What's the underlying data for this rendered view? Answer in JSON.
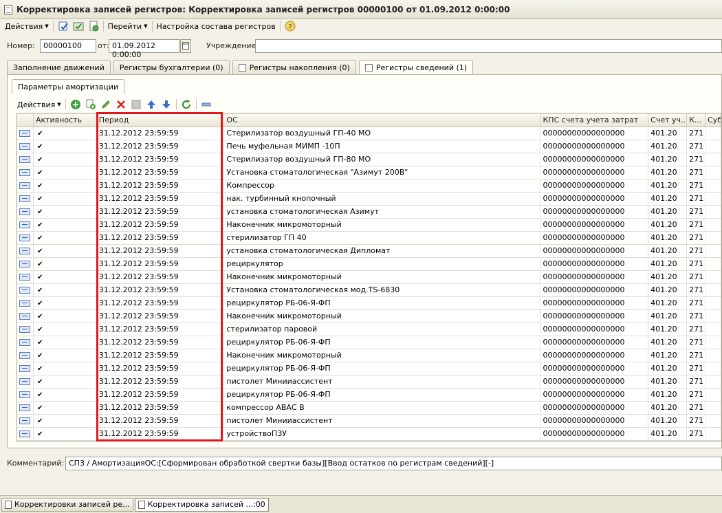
{
  "window": {
    "title": "Корректировка записей регистров: Корректировка записей регистров 00000100 от 01.09.2012 0:00:00"
  },
  "toolbar": {
    "actions_label": "Действия",
    "goto_label": "Перейти",
    "registers_setup_label": "Настройка состава регистров"
  },
  "header": {
    "number_label": "Номер:",
    "number_value": "00000100",
    "date_label": "от:",
    "date_value": "01.09.2012  0:00:00",
    "institution_label": "Учреждение:",
    "institution_value": ""
  },
  "tabs": [
    {
      "label": "Заполнение движений"
    },
    {
      "label": "Регистры бухгалтерии (0)"
    },
    {
      "label": "Регистры накопления (0)"
    },
    {
      "label": "Регистры сведений (1)"
    }
  ],
  "subtab": {
    "label": "Параметры амортизации"
  },
  "grid_toolbar": {
    "actions_label": "Действия"
  },
  "grid": {
    "columns": [
      "Активность",
      "Период",
      "ОС",
      "КПС счета учета затрат",
      "Счет уч...",
      "К...",
      "Суб"
    ],
    "rows": [
      {
        "period": "31.12.2012 23:59:59",
        "os": "Стерилизатор воздушный ГП-40 МО",
        "kps": "00000000000000000",
        "account": "401.20",
        "k": "271"
      },
      {
        "period": "31.12.2012 23:59:59",
        "os": "Печь муфельная  МИМП -10П",
        "kps": "00000000000000000",
        "account": "401.20",
        "k": "271"
      },
      {
        "period": "31.12.2012 23:59:59",
        "os": "Стерилизатор воздушный ГП-80 МО",
        "kps": "00000000000000000",
        "account": "401.20",
        "k": "271"
      },
      {
        "period": "31.12.2012 23:59:59",
        "os": "Установка стоматологическая \"Азимут 200В\"",
        "kps": "00000000000000000",
        "account": "401.20",
        "k": "271"
      },
      {
        "period": "31.12.2012 23:59:59",
        "os": "Компрессор",
        "kps": "00000000000000000",
        "account": "401.20",
        "k": "271"
      },
      {
        "period": "31.12.2012 23:59:59",
        "os": "нак. турбинный кнопочный",
        "kps": "00000000000000000",
        "account": "401.20",
        "k": "271"
      },
      {
        "period": "31.12.2012 23:59:59",
        "os": "установка стоматологическая Азимут",
        "kps": "00000000000000000",
        "account": "401.20",
        "k": "271"
      },
      {
        "period": "31.12.2012 23:59:59",
        "os": "Наконечник   микромоторный",
        "kps": "00000000000000000",
        "account": "401.20",
        "k": "271"
      },
      {
        "period": "31.12.2012 23:59:59",
        "os": "стерилизатор ГП 40",
        "kps": "00000000000000000",
        "account": "401.20",
        "k": "271"
      },
      {
        "period": "31.12.2012 23:59:59",
        "os": "установка стоматологическая Дипломат",
        "kps": "00000000000000000",
        "account": "401.20",
        "k": "271"
      },
      {
        "period": "31.12.2012 23:59:59",
        "os": "рециркулятор",
        "kps": "00000000000000000",
        "account": "401.20",
        "k": "271"
      },
      {
        "period": "31.12.2012 23:59:59",
        "os": "Наконечник   микромоторный",
        "kps": "00000000000000000",
        "account": "401.20",
        "k": "271"
      },
      {
        "period": "31.12.2012 23:59:59",
        "os": "Установка стоматологическая мод.TS-6830",
        "kps": "00000000000000000",
        "account": "401.20",
        "k": "271"
      },
      {
        "period": "31.12.2012 23:59:59",
        "os": "рециркулятор РБ-06-Я-ФП",
        "kps": "00000000000000000",
        "account": "401.20",
        "k": "271"
      },
      {
        "period": "31.12.2012 23:59:59",
        "os": "Наконечник   микромоторный",
        "kps": "00000000000000000",
        "account": "401.20",
        "k": "271"
      },
      {
        "period": "31.12.2012 23:59:59",
        "os": "стерилизатор паровой",
        "kps": "00000000000000000",
        "account": "401.20",
        "k": "271"
      },
      {
        "period": "31.12.2012 23:59:59",
        "os": "рециркулятор РБ-06-Я-ФП",
        "kps": "00000000000000000",
        "account": "401.20",
        "k": "271"
      },
      {
        "period": "31.12.2012 23:59:59",
        "os": "Наконечник   микромоторный",
        "kps": "00000000000000000",
        "account": "401.20",
        "k": "271"
      },
      {
        "period": "31.12.2012 23:59:59",
        "os": "рециркулятор РБ-06-Я-ФП",
        "kps": "00000000000000000",
        "account": "401.20",
        "k": "271"
      },
      {
        "period": "31.12.2012 23:59:59",
        "os": "пистолет Минииассистент",
        "kps": "00000000000000000",
        "account": "401.20",
        "k": "271"
      },
      {
        "period": "31.12.2012 23:59:59",
        "os": "рециркулятор РБ-06-Я-ФП",
        "kps": "00000000000000000",
        "account": "401.20",
        "k": "271"
      },
      {
        "period": "31.12.2012 23:59:59",
        "os": "компрессор АВАС В",
        "kps": "00000000000000000",
        "account": "401.20",
        "k": "271"
      },
      {
        "period": "31.12.2012 23:59:59",
        "os": "пистолет Минииассистент",
        "kps": "00000000000000000",
        "account": "401.20",
        "k": "271"
      },
      {
        "period": "31.12.2012 23:59:59",
        "os": "устройствоПЗУ",
        "kps": "00000000000000000",
        "account": "401.20",
        "k": "271"
      }
    ]
  },
  "comment": {
    "label": "Комментарий:",
    "value": "СП3 / АмортизацияОС:[Сформирован обработкой свертки базы][Ввод остатков по регистрам сведений][-]"
  },
  "taskbar": {
    "items": [
      {
        "label": "Корректировки записей ре..."
      },
      {
        "label": "Корректировка записей ...:00"
      }
    ]
  },
  "colors": {
    "highlight": "#e0181c",
    "toolbar_add": "#3aa53a",
    "toolbar_delete": "#d62020",
    "toolbar_arrow": "#3a6fd0"
  }
}
